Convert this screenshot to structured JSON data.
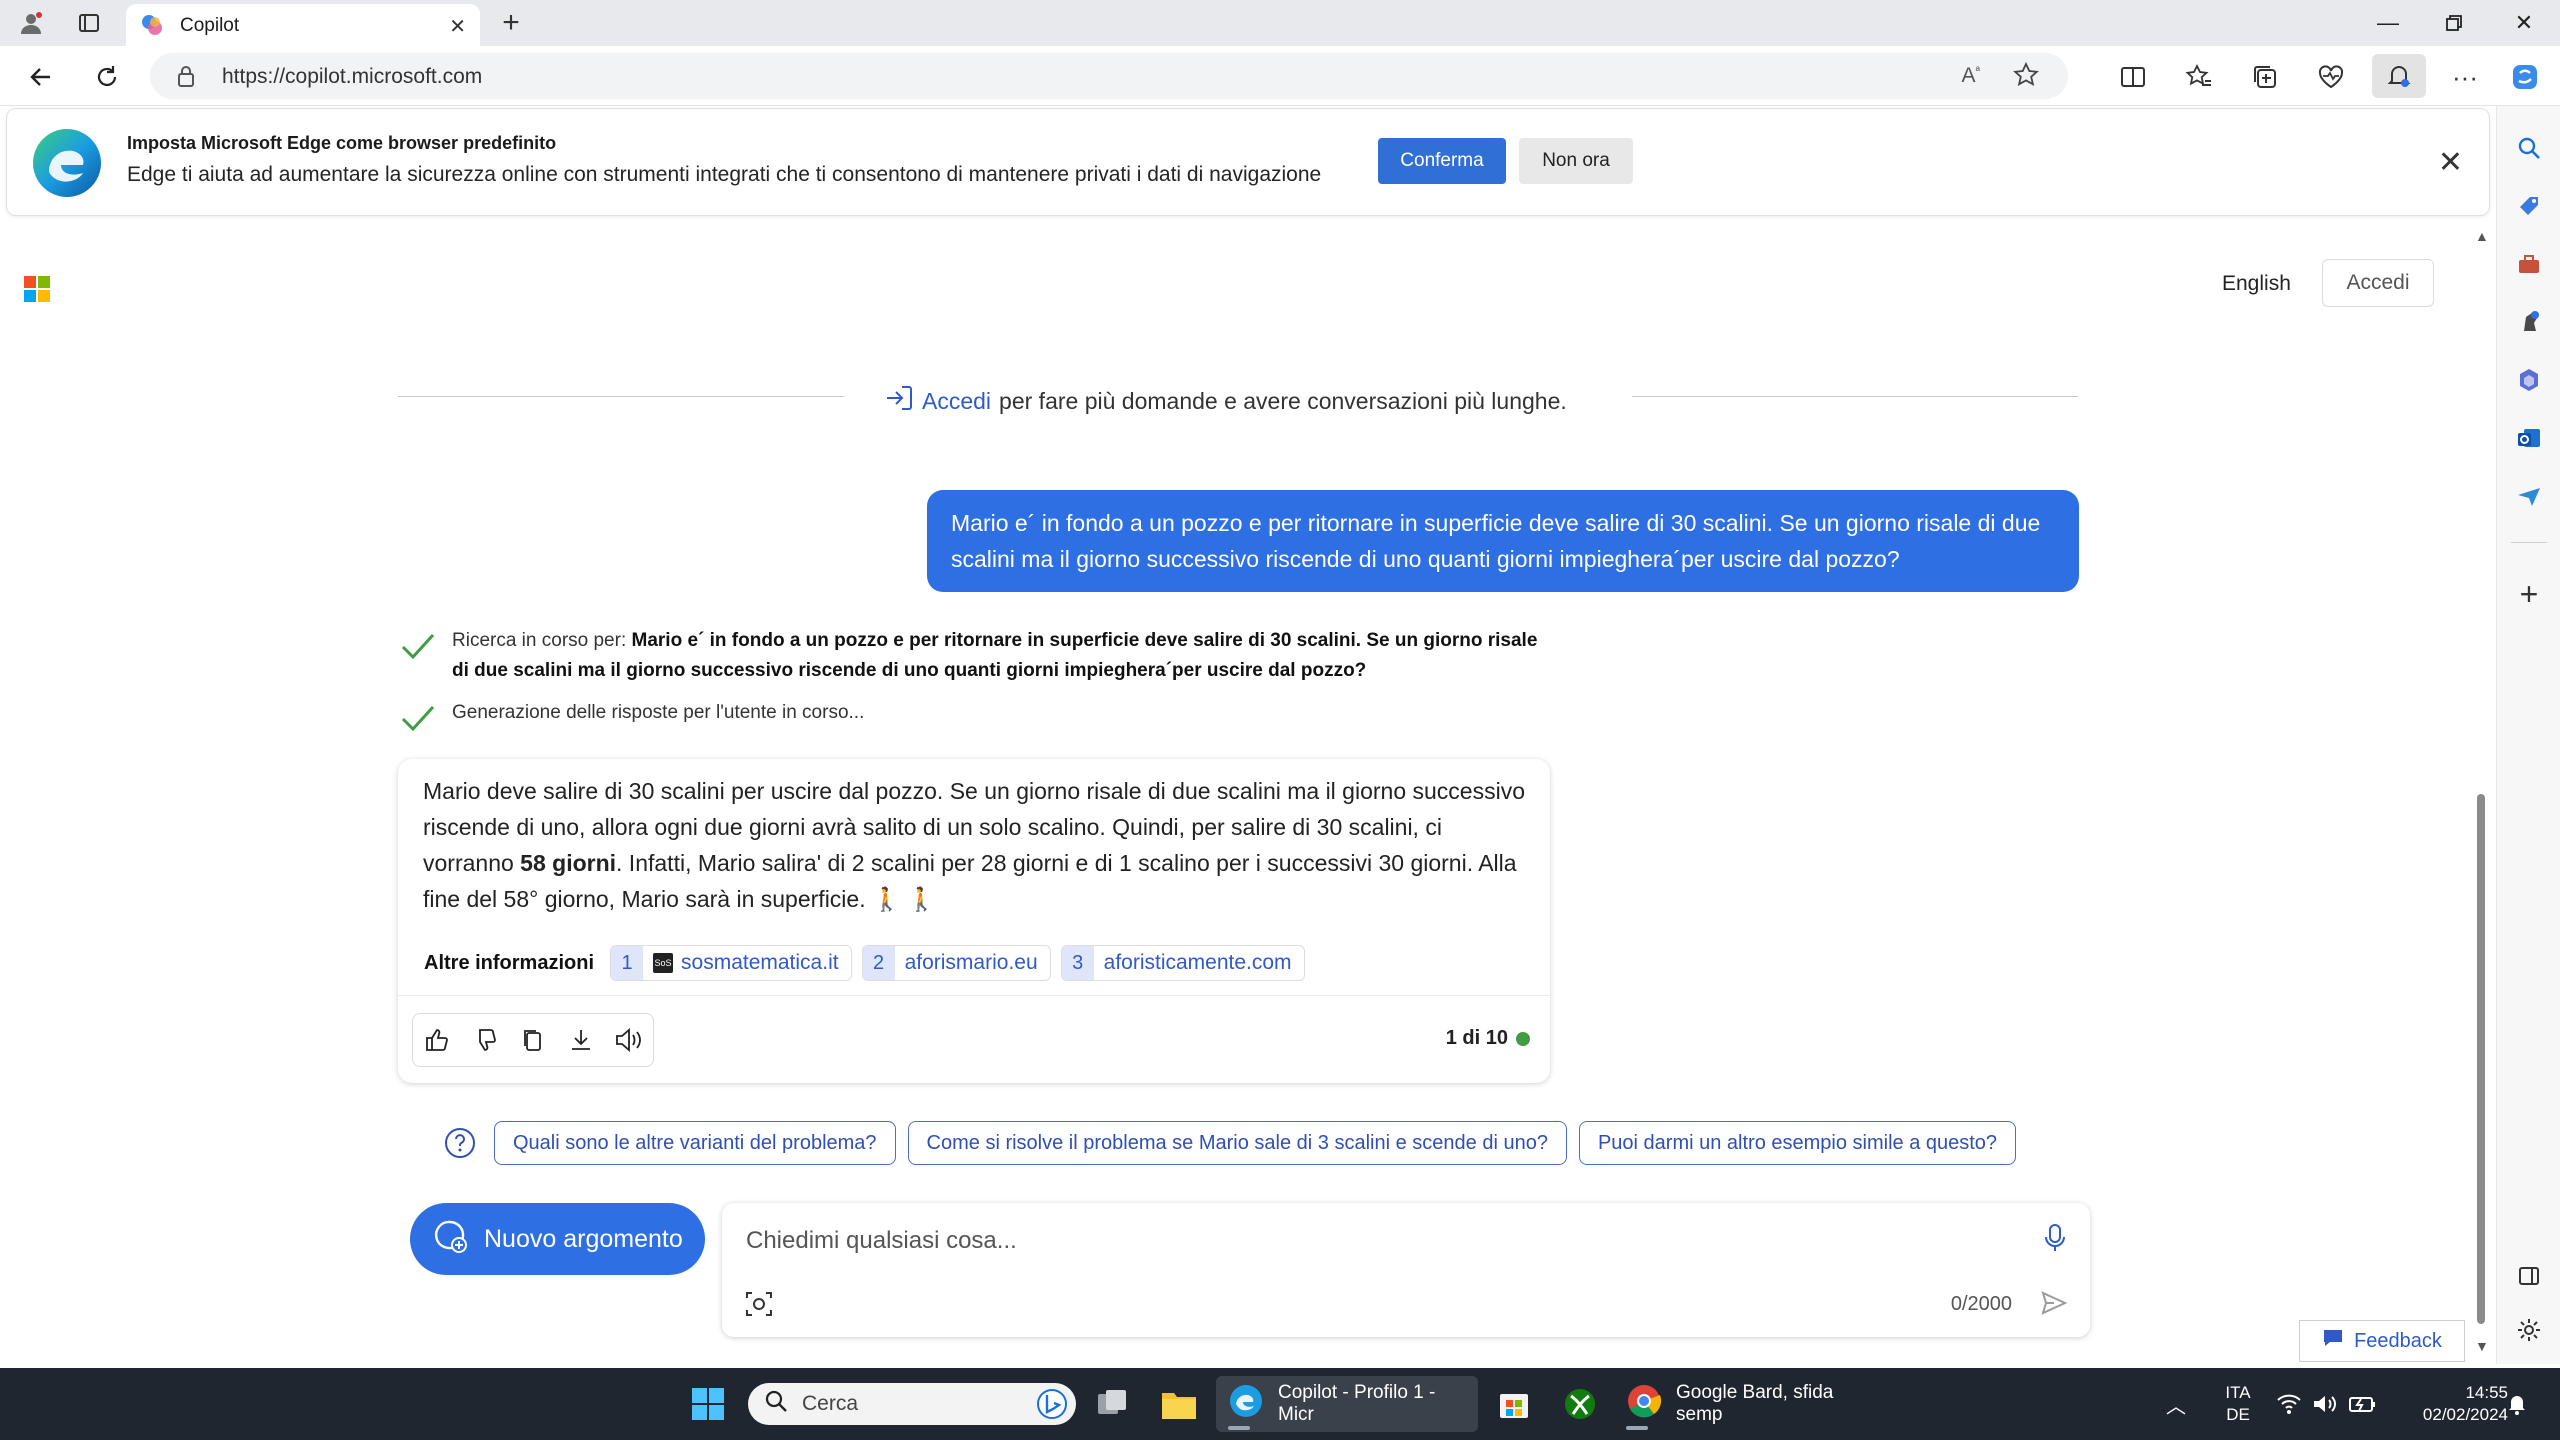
{
  "browser": {
    "tab_title": "Copilot",
    "url": "https://copilot.microsoft.com"
  },
  "banner": {
    "title": "Imposta Microsoft Edge come browser predefinito",
    "body": "Edge ti aiuta ad aumentare la sicurezza online con strumenti integrati che ti consentono di mantenere privati i dati di navigazione",
    "confirm_label": "Conferma",
    "later_label": "Non ora"
  },
  "header": {
    "language": "English",
    "signin": "Accedi"
  },
  "signin_prompt": {
    "link": "Accedi",
    "text": "per fare più domande e avere conversazioni più lunghe."
  },
  "user_message": "Mario e´ in fondo a un pozzo e per ritornare in superficie deve salire di 30 scalini. Se un giorno risale di due scalini ma il giorno successivo riscende di uno quanti giorni impieghera´per uscire dal pozzo?",
  "status": {
    "searching_prefix": "Ricerca in corso per:",
    "searching_query": "Mario e´ in fondo a un pozzo e per ritornare in superficie deve salire di 30 scalini. Se un giorno risale di due scalini ma il giorno successivo riscende di uno quanti giorni impieghera´per uscire dal pozzo?",
    "generating": "Generazione delle risposte per l'utente in corso..."
  },
  "answer": {
    "part1": "Mario deve salire di 30 scalini per uscire dal pozzo. Se un giorno risale di due scalini ma il giorno successivo riscende di uno, allora ogni due giorni avrà salito di un solo scalino. Quindi, per salire di 30 scalini, ci vorranno ",
    "bold": "58 giorni",
    "part2": ". Infatti, Mario salira' di 2 scalini per 28 giorni e di 1 scalino per i successivi 30 giorni. Alla fine del 58° giorno, Mario sarà in superficie. 🚶 🚶",
    "more_info_label": "Altre informazioni",
    "sources": [
      {
        "num": "1",
        "label": "sosmatematica.it"
      },
      {
        "num": "2",
        "label": "aforismario.eu"
      },
      {
        "num": "3",
        "label": "aforisticamente.com"
      }
    ],
    "counter": "1 di 10"
  },
  "suggestions": [
    "Quali sono le altre varianti del problema?",
    "Come si risolve il problema se Mario sale di 3 scalini e scende di uno?",
    "Puoi darmi un altro esempio simile a questo?"
  ],
  "composer": {
    "new_topic": "Nuovo argomento",
    "placeholder": "Chiedimi qualsiasi cosa...",
    "char_count": "0/2000"
  },
  "feedback_label": "Feedback",
  "taskbar": {
    "search_placeholder": "Cerca",
    "edge_app": "Copilot - Profilo 1 - Micr",
    "chrome_app": "Google Bard, sfida semp",
    "lang_top": "ITA",
    "lang_bottom": "DE",
    "time": "14:55",
    "date": "02/02/2024"
  },
  "colors": {
    "accent": "#2f6fe4",
    "link": "#2f5ac8",
    "check": "#3f9c3f",
    "taskbar": "#1f2630"
  }
}
